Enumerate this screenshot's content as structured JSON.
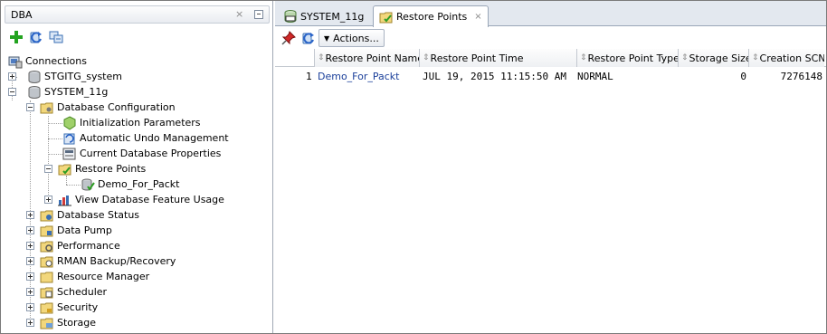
{
  "dba_panel": {
    "title": "DBA",
    "close_glyph": "×",
    "toolbar": {
      "add_icon": "add-connection-icon",
      "refresh_icon": "refresh-icon",
      "filter_icon": "filter-icon"
    },
    "tree": {
      "root": "Connections",
      "connection_1": "STGITG_system",
      "connection_2": "SYSTEM_11g",
      "db_config": "Database Configuration",
      "init_params": "Initialization Parameters",
      "undo_mgmt": "Automatic Undo Management",
      "db_props": "Current Database Properties",
      "restore_points": "Restore Points",
      "demo_rp": "Demo_For_Packt",
      "feature_usage": "View Database Feature Usage",
      "db_status": "Database Status",
      "data_pump": "Data Pump",
      "performance": "Performance",
      "rman": "RMAN Backup/Recovery",
      "resource_mgr": "Resource Manager",
      "scheduler": "Scheduler",
      "security": "Security",
      "storage": "Storage"
    }
  },
  "tabs": [
    {
      "label": "SYSTEM_11g",
      "icon": "sql-worksheet-icon"
    },
    {
      "label": "Restore Points",
      "icon": "restore-points-icon",
      "close": "×"
    }
  ],
  "toolbar": {
    "pin_icon": "pin-icon",
    "refresh_icon": "refresh-icon",
    "actions_label": "Actions..."
  },
  "grid": {
    "columns": [
      "Restore Point Name",
      "Restore Point Time",
      "Restore Point Type",
      "Storage Size",
      "Creation SCN"
    ],
    "rows": [
      {
        "num": "1",
        "name": "Demo_For_Packt",
        "time": "JUL 19, 2015 11:15:50 AM",
        "type": "NORMAL",
        "size": "0",
        "scn": "7276148"
      }
    ]
  }
}
